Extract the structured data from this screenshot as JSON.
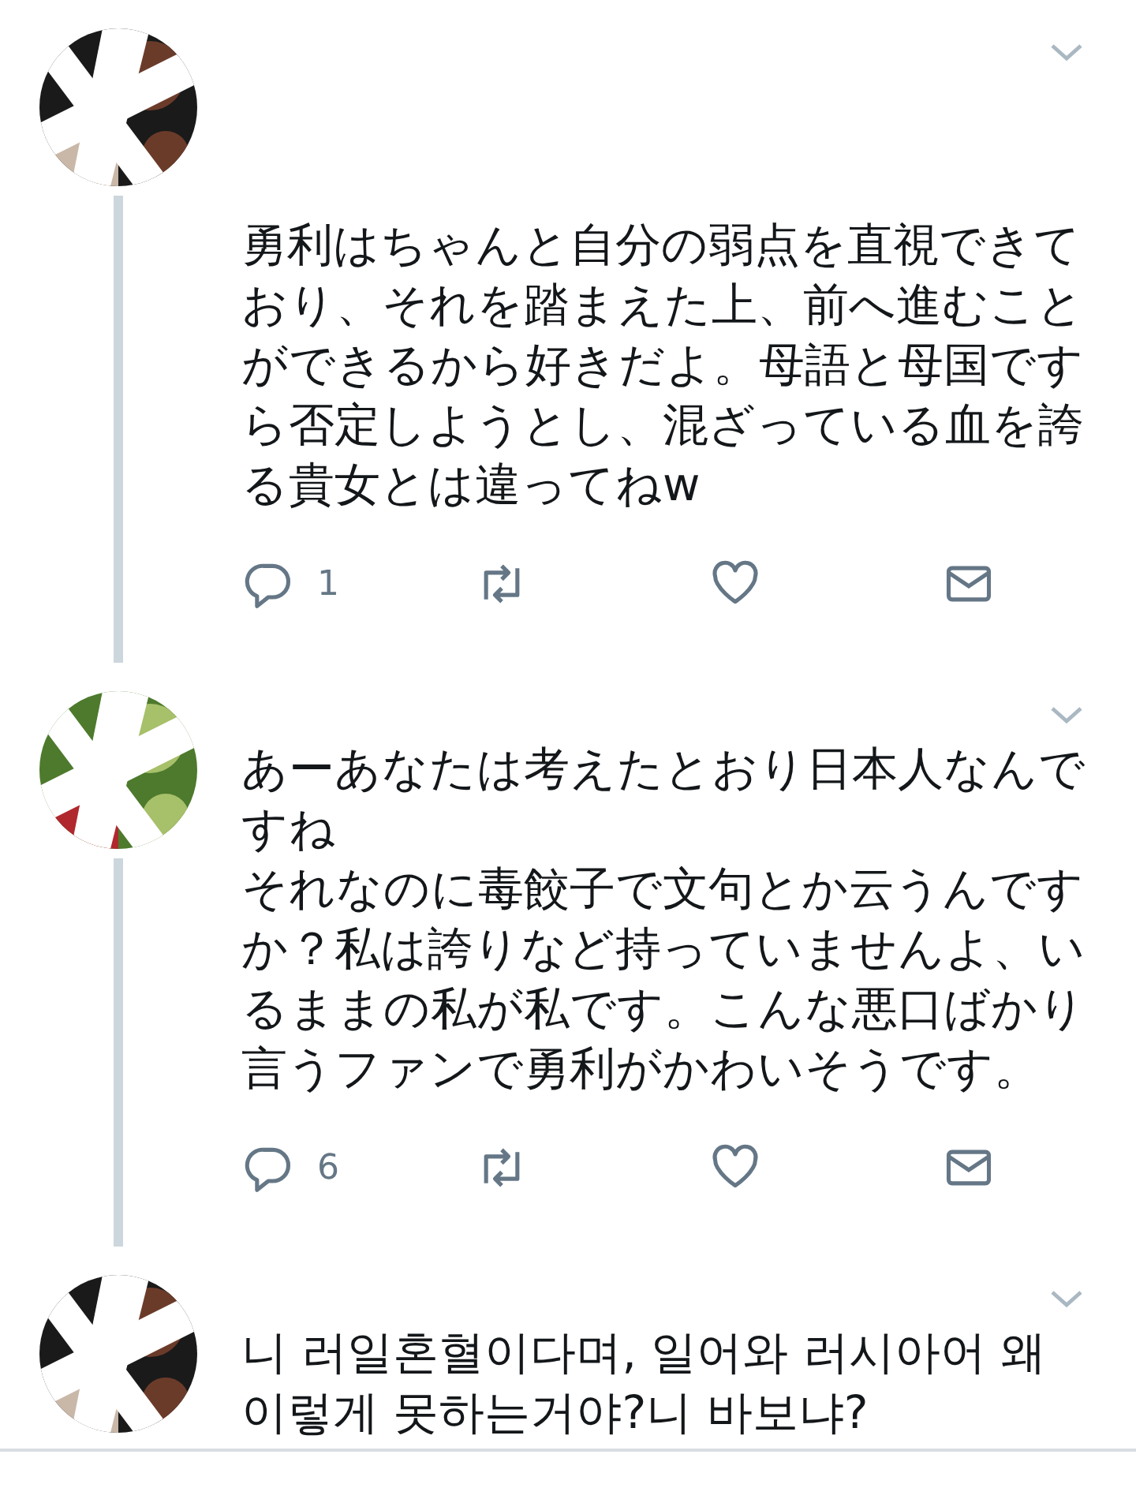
{
  "tweets": [
    {
      "paragraphs": [
        "勇利はちゃんと自分の弱点を直視できており、それを踏まえた上、前へ進むことができるから好きだよ。母語と母国ですら否定しようとし、混ざっている血を誇る貴女とは違ってねw"
      ],
      "thread_below": true,
      "actions": {
        "replies": "1"
      }
    },
    {
      "paragraphs": [
        "あーあなたは考えたとおり日本人なんですね",
        "それなのに毒餃子で文句とか云うんですか？私は誇りなど持っていませんよ、いるままの私が私です。こんな悪口ばかり言うファンで勇利がかわいそうです。"
      ],
      "thread_below": true,
      "actions": {
        "replies": "6"
      }
    },
    {
      "paragraphs": [
        "니 러일혼혈이다며, 일어와 러시아어 왜 이렇게 못하는거야?니 바보냐?"
      ],
      "thread_below": false
    }
  ]
}
